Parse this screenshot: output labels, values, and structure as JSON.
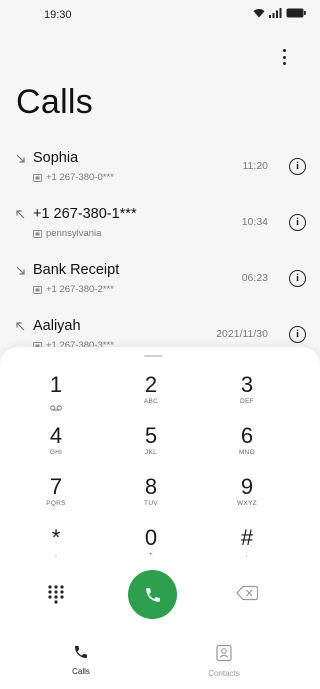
{
  "status_bar": {
    "time": "19:30"
  },
  "header": {
    "title": "Calls"
  },
  "calls": [
    {
      "name": "Sophia",
      "number": "+1 267-380-0***",
      "time": "11:20",
      "direction": "incoming"
    },
    {
      "name": "+1 267-380-1***",
      "number": "pennsylvania",
      "time": "10:34",
      "direction": "outgoing"
    },
    {
      "name": "Bank Receipt",
      "number": "+1 267-380-2***",
      "time": "06:23",
      "direction": "incoming"
    },
    {
      "name": "Aaliyah",
      "number": "+1 267-380-3***",
      "time": "2021/11/30",
      "direction": "outgoing"
    }
  ],
  "dialpad": {
    "keys": [
      {
        "digit": "1",
        "letters": ""
      },
      {
        "digit": "2",
        "letters": "ABC"
      },
      {
        "digit": "3",
        "letters": "DEF"
      },
      {
        "digit": "4",
        "letters": "GHI"
      },
      {
        "digit": "5",
        "letters": "JKL"
      },
      {
        "digit": "6",
        "letters": "MNO"
      },
      {
        "digit": "7",
        "letters": "PQRS"
      },
      {
        "digit": "8",
        "letters": "TUV"
      },
      {
        "digit": "9",
        "letters": "WXYZ"
      },
      {
        "digit": "*",
        "letters": ","
      },
      {
        "digit": "0",
        "letters": "+"
      },
      {
        "digit": "#",
        "letters": ";"
      }
    ]
  },
  "nav": {
    "calls_label": "Calls",
    "contacts_label": "Contacts"
  },
  "colors": {
    "call_button": "#2e9e4f",
    "background": "#f5f5f5"
  }
}
